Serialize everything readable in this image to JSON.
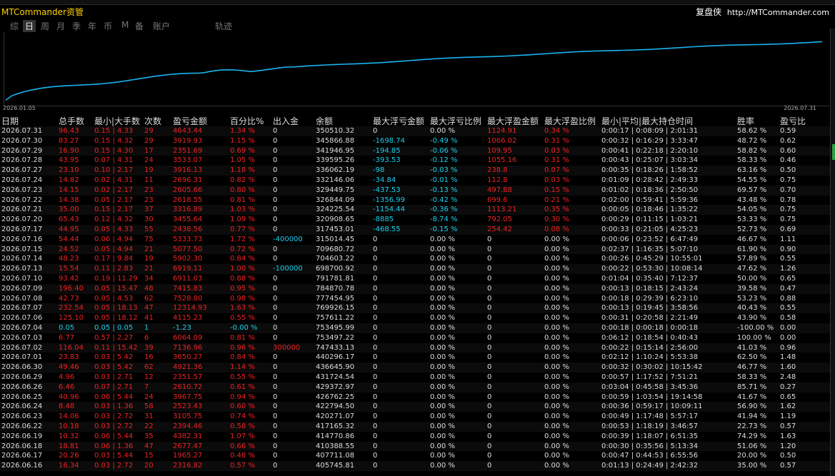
{
  "header": {
    "app_title": "MTCommander资管",
    "brand": "复盘侠",
    "url": "http://MTCommander.com"
  },
  "tabs": [
    {
      "label": "综",
      "active": false
    },
    {
      "label": "日",
      "active": true
    },
    {
      "label": "周",
      "active": false
    },
    {
      "label": "月",
      "active": false
    },
    {
      "label": "季",
      "active": false
    },
    {
      "label": "年",
      "active": false
    },
    {
      "label": "币",
      "active": false
    },
    {
      "label": "M",
      "active": false
    },
    {
      "label": "备",
      "active": false
    },
    {
      "label": "账户",
      "active": false
    },
    {
      "label": "轨迹",
      "active": false
    }
  ],
  "chart": {
    "date_start": "2026.01.05",
    "date_end": "2026.07.31",
    "line_color": "#1ab4f0"
  },
  "columns": [
    "日期",
    "总手数",
    "最小|大手数",
    "次数",
    "盈亏金额",
    "百分比%",
    "出入金",
    "余额",
    "最大浮亏金额",
    "最大浮亏比例",
    "最大浮盈金额",
    "最大浮盈比例",
    "最小|平均|最大持仓时间",
    "胜率",
    "盈亏比"
  ],
  "rows": [
    {
      "date": "2026.07.31",
      "lots": "96.43",
      "minmax": "0.15 | 4.33",
      "count": "29",
      "pnl": "4643.44",
      "pct": "1.34 %",
      "flow": "0",
      "balance": "350510.32",
      "maxloss": "0",
      "maxloss_pct": "0.00 %",
      "maxgain": "1124.91",
      "maxgain_pct": "0.34 %",
      "hold": "0:00:17 | 0:08:09 | 2:01:31",
      "winrate": "58.62 %",
      "pl": "0.59",
      "c": "r",
      "lc": "w",
      "gc": "r"
    },
    {
      "date": "2026.07.30",
      "lots": "83.27",
      "minmax": "0.15 | 4.32",
      "count": "29",
      "pnl": "3919.93",
      "pct": "1.15 %",
      "flow": "0",
      "balance": "345866.88",
      "maxloss": "-1698.74",
      "maxloss_pct": "-0.49 %",
      "maxgain": "1066.02",
      "maxgain_pct": "0.31 %",
      "hold": "0:00:32 | 0:16:29 | 3:33:47",
      "winrate": "48.72 %",
      "pl": "0.62",
      "c": "r",
      "lc": "c",
      "gc": "r"
    },
    {
      "date": "2026.07.29",
      "lots": "16.90",
      "minmax": "0.15 | 4.30",
      "count": "17",
      "pnl": "2351.69",
      "pct": "0.69 %",
      "flow": "0",
      "balance": "341946.95",
      "maxloss": "-194.85",
      "maxloss_pct": "-0.06 %",
      "maxgain": "109.95",
      "maxgain_pct": "0.03 %",
      "hold": "0:00:41 | 0:22:18 | 2:20:10",
      "winrate": "58.82 %",
      "pl": "0.60",
      "c": "r",
      "lc": "c",
      "gc": "r"
    },
    {
      "date": "2026.07.28",
      "lots": "43.95",
      "minmax": "0.07 | 4.31",
      "count": "24",
      "pnl": "3533.07",
      "pct": "1.05 %",
      "flow": "0",
      "balance": "339595.26",
      "maxloss": "-393.53",
      "maxloss_pct": "-0.12 %",
      "maxgain": "1055.16",
      "maxgain_pct": "0.31 %",
      "hold": "0:00:43 | 0:25:07 | 3:03:34",
      "winrate": "58.33 %",
      "pl": "0.46",
      "c": "r",
      "lc": "c",
      "gc": "r"
    },
    {
      "date": "2026.07.27",
      "lots": "23.10",
      "minmax": "0.10 | 2.17",
      "count": "19",
      "pnl": "3916.13",
      "pct": "1.18 %",
      "flow": "0",
      "balance": "336062.19",
      "maxloss": "-98",
      "maxloss_pct": "-0.03 %",
      "maxgain": "238.8",
      "maxgain_pct": "0.07 %",
      "hold": "0:00:35 | 0:18:26 | 1:58:52",
      "winrate": "63.16 %",
      "pl": "0.50",
      "c": "r",
      "lc": "c",
      "gc": "r"
    },
    {
      "date": "2026.07.24",
      "lots": "14.82",
      "minmax": "0.02 | 4.31",
      "count": "11",
      "pnl": "2696.31",
      "pct": "0.82 %",
      "flow": "0",
      "balance": "332146.06",
      "maxloss": "-34.84",
      "maxloss_pct": "-0.01 %",
      "maxgain": "112.8",
      "maxgain_pct": "0.03 %",
      "hold": "0:01:09 | 0:28:42 | 2:49:33",
      "winrate": "54.55 %",
      "pl": "0.75",
      "c": "r",
      "lc": "c",
      "gc": "r"
    },
    {
      "date": "2026.07.23",
      "lots": "14.15",
      "minmax": "0.02 | 2.17",
      "count": "23",
      "pnl": "2605.66",
      "pct": "0.80 %",
      "flow": "0",
      "balance": "329449.75",
      "maxloss": "-437.53",
      "maxloss_pct": "-0.13 %",
      "maxgain": "497.88",
      "maxgain_pct": "0.15 %",
      "hold": "0:01:02 | 0:18:36 | 2:50:50",
      "winrate": "69.57 %",
      "pl": "0.70",
      "c": "r",
      "lc": "c",
      "gc": "r"
    },
    {
      "date": "2026.07.22",
      "lots": "14.38",
      "minmax": "0.05 | 2.17",
      "count": "23",
      "pnl": "2618.55",
      "pct": "0.81 %",
      "flow": "0",
      "balance": "326844.09",
      "maxloss": "-1356.99",
      "maxloss_pct": "-0.42 %",
      "maxgain": "699.6",
      "maxgain_pct": "0.21 %",
      "hold": "0:02:00 | 0:59:41 | 5:59:36",
      "winrate": "43.48 %",
      "pl": "0.78",
      "c": "r",
      "lc": "c",
      "gc": "r"
    },
    {
      "date": "2026.07.21",
      "lots": "35.00",
      "minmax": "0.15 | 2.17",
      "count": "37",
      "pnl": "3316.89",
      "pct": "1.03 %",
      "flow": "0",
      "balance": "324225.54",
      "maxloss": "-1154.44",
      "maxloss_pct": "-0.36 %",
      "maxgain": "1113.21",
      "maxgain_pct": "0.35 %",
      "hold": "0:00:05 | 0:18:46 | 1:35:22",
      "winrate": "54.05 %",
      "pl": "0.75",
      "c": "r",
      "lc": "c",
      "gc": "r"
    },
    {
      "date": "2026.07.20",
      "lots": "65.43",
      "minmax": "0.12 | 4.32",
      "count": "30",
      "pnl": "3455.64",
      "pct": "1.09 %",
      "flow": "0",
      "balance": "320908.65",
      "maxloss": "-8885",
      "maxloss_pct": "-8.74 %",
      "maxgain": "792.05",
      "maxgain_pct": "0.30 %",
      "hold": "0:00:29 | 0:11:15 | 1:03:21",
      "winrate": "53.33 %",
      "pl": "0.75",
      "c": "r",
      "lc": "c",
      "gc": "r"
    },
    {
      "date": "2026.07.17",
      "lots": "44.95",
      "minmax": "0.05 | 4.33",
      "count": "55",
      "pnl": "2438.56",
      "pct": "0.77 %",
      "flow": "0",
      "balance": "317453.01",
      "maxloss": "-468.55",
      "maxloss_pct": "-0.15 %",
      "maxgain": "254.42",
      "maxgain_pct": "0.08 %",
      "hold": "0:00:33 | 0:21:05 | 4:25:23",
      "winrate": "52.73 %",
      "pl": "0.69",
      "c": "r",
      "lc": "c",
      "gc": "r"
    },
    {
      "date": "2026.07.16",
      "lots": "54.44",
      "minmax": "0.06 | 4.94",
      "count": "75",
      "pnl": "5333.73",
      "pct": "1.72 %",
      "flow": "-400000",
      "balance": "315014.45",
      "maxloss": "0",
      "maxloss_pct": "0.00 %",
      "maxgain": "0",
      "maxgain_pct": "0.00 %",
      "hold": "0:00:06 | 0:23:52 | 6:47:49",
      "winrate": "46.67 %",
      "pl": "1.11",
      "c": "r",
      "lc": "w",
      "gc": "w",
      "fc": "c"
    },
    {
      "date": "2026.07.15",
      "lots": "24.52",
      "minmax": "0.05 | 4.94",
      "count": "21",
      "pnl": "5077.50",
      "pct": "0.72 %",
      "flow": "0",
      "balance": "709680.72",
      "maxloss": "0",
      "maxloss_pct": "0.00 %",
      "maxgain": "0",
      "maxgain_pct": "0.00 %",
      "hold": "0:02:37 | 1:16:35 | 5:07:10",
      "winrate": "61.90 %",
      "pl": "0.90",
      "c": "r",
      "lc": "w",
      "gc": "w"
    },
    {
      "date": "2026.07.14",
      "lots": "48.23",
      "minmax": "0.17 | 9.84",
      "count": "19",
      "pnl": "5902.30",
      "pct": "0.84 %",
      "flow": "0",
      "balance": "704603.22",
      "maxloss": "0",
      "maxloss_pct": "0.00 %",
      "maxgain": "0",
      "maxgain_pct": "0.00 %",
      "hold": "0:00:26 | 0:45:29 | 10:55:01",
      "winrate": "57.89 %",
      "pl": "0.55",
      "c": "r",
      "lc": "w",
      "gc": "w"
    },
    {
      "date": "2026.07.13",
      "lots": "15.54",
      "minmax": "0.11 | 2.83",
      "count": "21",
      "pnl": "6919.11",
      "pct": "1.00 %",
      "flow": "-100000",
      "balance": "698700.92",
      "maxloss": "0",
      "maxloss_pct": "0.00 %",
      "maxgain": "0",
      "maxgain_pct": "0.00 %",
      "hold": "0:00:22 | 0:53:30 | 10:08:14",
      "winrate": "47.62 %",
      "pl": "1.26",
      "c": "r",
      "lc": "w",
      "gc": "w",
      "fc": "c"
    },
    {
      "date": "2026.07.10",
      "lots": "93.42",
      "minmax": "0.19 | 11.29",
      "count": "34",
      "pnl": "6911.03",
      "pct": "0.88 %",
      "flow": "0",
      "balance": "791781.81",
      "maxloss": "0",
      "maxloss_pct": "0.00 %",
      "maxgain": "0",
      "maxgain_pct": "0.00 %",
      "hold": "0:01:04 | 0:35:40 | 7:12:37",
      "winrate": "50.00 %",
      "pl": "0.65",
      "c": "r",
      "lc": "w",
      "gc": "w"
    },
    {
      "date": "2026.07.09",
      "lots": "196.40",
      "minmax": "0.05 | 15.47",
      "count": "48",
      "pnl": "7415.83",
      "pct": "0.95 %",
      "flow": "0",
      "balance": "784870.78",
      "maxloss": "0",
      "maxloss_pct": "0.00 %",
      "maxgain": "0",
      "maxgain_pct": "0.00 %",
      "hold": "0:00:13 | 0:18:15 | 2:43:24",
      "winrate": "39.58 %",
      "pl": "0.47",
      "c": "r",
      "lc": "w",
      "gc": "w"
    },
    {
      "date": "2026.07.08",
      "lots": "42.73",
      "minmax": "0.05 | 4.53",
      "count": "62",
      "pnl": "7528.80",
      "pct": "0.98 %",
      "flow": "0",
      "balance": "777454.95",
      "maxloss": "0",
      "maxloss_pct": "0.00 %",
      "maxgain": "0",
      "maxgain_pct": "0.00 %",
      "hold": "0:00:18 | 0:29:39 | 6:23:10",
      "winrate": "53.23 %",
      "pl": "0.88",
      "c": "r",
      "lc": "w",
      "gc": "w"
    },
    {
      "date": "2026.07.07",
      "lots": "232.54",
      "minmax": "0.05 | 18.13",
      "count": "47",
      "pnl": "12314.93",
      "pct": "1.63 %",
      "flow": "0",
      "balance": "769926.15",
      "maxloss": "0",
      "maxloss_pct": "0.00 %",
      "maxgain": "0",
      "maxgain_pct": "0.00 %",
      "hold": "0:00:13 | 0:19:45 | 3:58:56",
      "winrate": "40.43 %",
      "pl": "0.55",
      "c": "r",
      "lc": "w",
      "gc": "w"
    },
    {
      "date": "2026.07.06",
      "lots": "125.10",
      "minmax": "0.05 | 18.12",
      "count": "41",
      "pnl": "4115.23",
      "pct": "0.55 %",
      "flow": "0",
      "balance": "757611.22",
      "maxloss": "0",
      "maxloss_pct": "0.00 %",
      "maxgain": "0",
      "maxgain_pct": "0.00 %",
      "hold": "0:00:31 | 0:20:58 | 2:21:49",
      "winrate": "43.90 %",
      "pl": "0.58",
      "c": "r",
      "lc": "w",
      "gc": "w"
    },
    {
      "date": "2026.07.04",
      "lots": "0.05",
      "minmax": "0.05 | 0.05",
      "count": "1",
      "pnl": "-1.23",
      "pct": "-0.00 %",
      "flow": "0",
      "balance": "753495.99",
      "maxloss": "0",
      "maxloss_pct": "0.00 %",
      "maxgain": "0",
      "maxgain_pct": "0.00 %",
      "hold": "0:00:18 | 0:00:18 | 0:00:18",
      "winrate": "-100.00 %",
      "pl": "0.00",
      "c": "c",
      "lc": "w",
      "gc": "w"
    },
    {
      "date": "2026.07.03",
      "lots": "6.77",
      "minmax": "0.57 | 2.27",
      "count": "6",
      "pnl": "6064.09",
      "pct": "0.81 %",
      "flow": "0",
      "balance": "753497.22",
      "maxloss": "0",
      "maxloss_pct": "0.00 %",
      "maxgain": "0",
      "maxgain_pct": "0.00 %",
      "hold": "0:06:12 | 0:18:54 | 0:40:43",
      "winrate": "100.00 %",
      "pl": "0.00",
      "c": "r",
      "lc": "w",
      "gc": "w"
    },
    {
      "date": "2026.07.02",
      "lots": "116.04",
      "minmax": "0.11 | 15.42",
      "count": "39",
      "pnl": "7136.96",
      "pct": "0.96 %",
      "flow": "300000",
      "balance": "747433.13",
      "maxloss": "0",
      "maxloss_pct": "0.00 %",
      "maxgain": "0",
      "maxgain_pct": "0.00 %",
      "hold": "0:00:22 | 0:15:14 | 2:56:00",
      "winrate": "41.03 %",
      "pl": "0.96",
      "c": "r",
      "lc": "w",
      "gc": "w",
      "fc": "r"
    },
    {
      "date": "2026.07.01",
      "lots": "23.83",
      "minmax": "0.03 | 5.42",
      "count": "16",
      "pnl": "3650.27",
      "pct": "0.84 %",
      "flow": "0",
      "balance": "440296.17",
      "maxloss": "0",
      "maxloss_pct": "0.00 %",
      "maxgain": "0",
      "maxgain_pct": "0.00 %",
      "hold": "0:02:12 | 1:10:24 | 5:53:38",
      "winrate": "62.50 %",
      "pl": "1.48",
      "c": "r",
      "lc": "w",
      "gc": "w"
    },
    {
      "date": "2026.06.30",
      "lots": "49.46",
      "minmax": "0.03 | 5.42",
      "count": "62",
      "pnl": "4921.36",
      "pct": "1.14 %",
      "flow": "0",
      "balance": "436645.90",
      "maxloss": "0",
      "maxloss_pct": "0.00 %",
      "maxgain": "0",
      "maxgain_pct": "0.00 %",
      "hold": "0:00:32 | 0:30:02 | 10:15:42",
      "winrate": "46.77 %",
      "pl": "1.60",
      "c": "r",
      "lc": "w",
      "gc": "w"
    },
    {
      "date": "2026.06.29",
      "lots": "4.96",
      "minmax": "0.03 | 2.71",
      "count": "12",
      "pnl": "2351.57",
      "pct": "0.55 %",
      "flow": "0",
      "balance": "431724.54",
      "maxloss": "0",
      "maxloss_pct": "0.00 %",
      "maxgain": "0",
      "maxgain_pct": "0.00 %",
      "hold": "0:00:57 | 1:17:52 | 7:51:21",
      "winrate": "58.33 %",
      "pl": "2.48",
      "c": "r",
      "lc": "w",
      "gc": "w"
    },
    {
      "date": "2026.06.26",
      "lots": "6.46",
      "minmax": "0.07 | 2.71",
      "count": "7",
      "pnl": "2610.72",
      "pct": "0.61 %",
      "flow": "0",
      "balance": "429372.97",
      "maxloss": "0",
      "maxloss_pct": "0.00 %",
      "maxgain": "0",
      "maxgain_pct": "0.00 %",
      "hold": "0:03:04 | 0:45:58 | 3:45:36",
      "winrate": "85.71 %",
      "pl": "0.27",
      "c": "r",
      "lc": "w",
      "gc": "w"
    },
    {
      "date": "2026.06.25",
      "lots": "40.96",
      "minmax": "0.06 | 5.44",
      "count": "24",
      "pnl": "3967.75",
      "pct": "0.94 %",
      "flow": "0",
      "balance": "426762.25",
      "maxloss": "0",
      "maxloss_pct": "0.00 %",
      "maxgain": "0",
      "maxgain_pct": "0.00 %",
      "hold": "0:00:59 | 1:03:54 | 19:14:58",
      "winrate": "41.67 %",
      "pl": "0.65",
      "c": "r",
      "lc": "w",
      "gc": "w"
    },
    {
      "date": "2026.06.24",
      "lots": "8.48",
      "minmax": "0.03 | 1.36",
      "count": "58",
      "pnl": "2523.43",
      "pct": "0.60 %",
      "flow": "0",
      "balance": "422794.50",
      "maxloss": "0",
      "maxloss_pct": "0.00 %",
      "maxgain": "0",
      "maxgain_pct": "0.00 %",
      "hold": "0:00:36 | 0:59:17 | 10:09:11",
      "winrate": "56.90 %",
      "pl": "1.62",
      "c": "r",
      "lc": "w",
      "gc": "w"
    },
    {
      "date": "2026.06.23",
      "lots": "14.06",
      "minmax": "0.03 | 2.72",
      "count": "31",
      "pnl": "3105.75",
      "pct": "0.74 %",
      "flow": "0",
      "balance": "420271.07",
      "maxloss": "0",
      "maxloss_pct": "0.00 %",
      "maxgain": "0",
      "maxgain_pct": "0.00 %",
      "hold": "0:00:49 | 1:17:48 | 5:57:17",
      "winrate": "41.94 %",
      "pl": "1.19",
      "c": "r",
      "lc": "w",
      "gc": "w"
    },
    {
      "date": "2026.06.22",
      "lots": "10.18",
      "minmax": "0.03 | 2.72",
      "count": "22",
      "pnl": "2394.46",
      "pct": "0.58 %",
      "flow": "0",
      "balance": "417165.32",
      "maxloss": "0",
      "maxloss_pct": "0.00 %",
      "maxgain": "0",
      "maxgain_pct": "0.00 %",
      "hold": "0:00:53 | 1:18:19 | 3:46:57",
      "winrate": "22.73 %",
      "pl": "0.57",
      "c": "r",
      "lc": "w",
      "gc": "w"
    },
    {
      "date": "2026.06.19",
      "lots": "10.32",
      "minmax": "0.06 | 5.44",
      "count": "35",
      "pnl": "4382.31",
      "pct": "1.07 %",
      "flow": "0",
      "balance": "414770.86",
      "maxloss": "0",
      "maxloss_pct": "0.00 %",
      "maxgain": "0",
      "maxgain_pct": "0.00 %",
      "hold": "0:00:39 | 1:18:07 | 6:51:35",
      "winrate": "74.29 %",
      "pl": "1.63",
      "c": "r",
      "lc": "w",
      "gc": "w"
    },
    {
      "date": "2026.06.18",
      "lots": "18.81",
      "minmax": "0.06 | 1.36",
      "count": "47",
      "pnl": "2677.47",
      "pct": "0.66 %",
      "flow": "0",
      "balance": "410388.55",
      "maxloss": "0",
      "maxloss_pct": "0.00 %",
      "maxgain": "0",
      "maxgain_pct": "0.00 %",
      "hold": "0:00:30 | 0:35:56 | 5:13:34",
      "winrate": "51.06 %",
      "pl": "1.20",
      "c": "r",
      "lc": "w",
      "gc": "w"
    },
    {
      "date": "2026.06.17",
      "lots": "20.26",
      "minmax": "0.03 | 5.44",
      "count": "15",
      "pnl": "1965.27",
      "pct": "0.48 %",
      "flow": "0",
      "balance": "407711.08",
      "maxloss": "0",
      "maxloss_pct": "0.00 %",
      "maxgain": "0",
      "maxgain_pct": "0.00 %",
      "hold": "0:00:47 | 0:44:53 | 6:55:56",
      "winrate": "20.00 %",
      "pl": "0.50",
      "c": "r",
      "lc": "w",
      "gc": "w"
    },
    {
      "date": "2026.06.16",
      "lots": "16.34",
      "minmax": "0.03 | 2.72",
      "count": "20",
      "pnl": "2316.82",
      "pct": "0.57 %",
      "flow": "0",
      "balance": "405745.81",
      "maxloss": "0",
      "maxloss_pct": "0.00 %",
      "maxgain": "0",
      "maxgain_pct": "0.00 %",
      "hold": "0:01:13 | 0:24:49 | 2:42:32",
      "winrate": "35.00 %",
      "pl": "0.57",
      "c": "r",
      "lc": "w",
      "gc": "w"
    }
  ]
}
